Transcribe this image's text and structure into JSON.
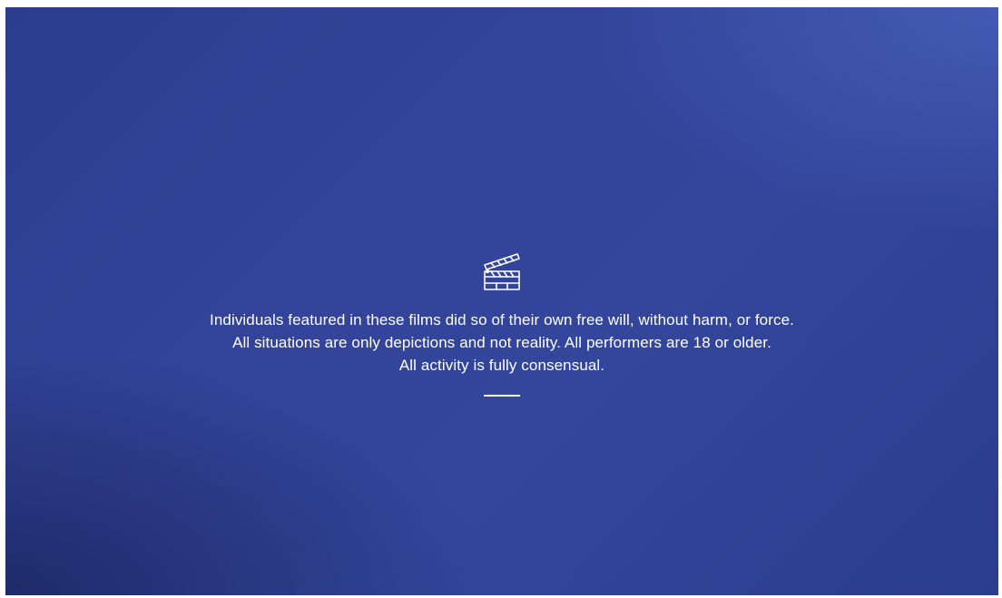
{
  "screen": {
    "background_color": "#33449a",
    "icon": "clapperboard-icon"
  },
  "disclaimer": {
    "lines": [
      "Individuals featured in these films did so of their own free will, without harm, or force.",
      "All situations are only depictions and not reality. All performers are 18 or older.",
      "All activity is fully consensual."
    ]
  }
}
